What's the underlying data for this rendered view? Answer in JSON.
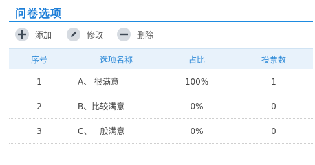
{
  "panel": {
    "title": "问卷选项"
  },
  "toolbar": {
    "add_label": "添加",
    "edit_label": "修改",
    "delete_label": "删除"
  },
  "table": {
    "columns": [
      "序号",
      "选项名称",
      "占比",
      "投票数"
    ],
    "rows": [
      {
        "no": "1",
        "name": "A、 很满意",
        "ratio": "100%",
        "votes": "1"
      },
      {
        "no": "2",
        "name": "B、比较满意",
        "ratio": "0%",
        "votes": "0"
      },
      {
        "no": "3",
        "name": "C、一般满意",
        "ratio": "0%",
        "votes": "0"
      }
    ]
  },
  "colors": {
    "accent": "#1e7fd8",
    "header_bg": "#e8f2fb",
    "icon_bg": "#d6dbe1"
  }
}
